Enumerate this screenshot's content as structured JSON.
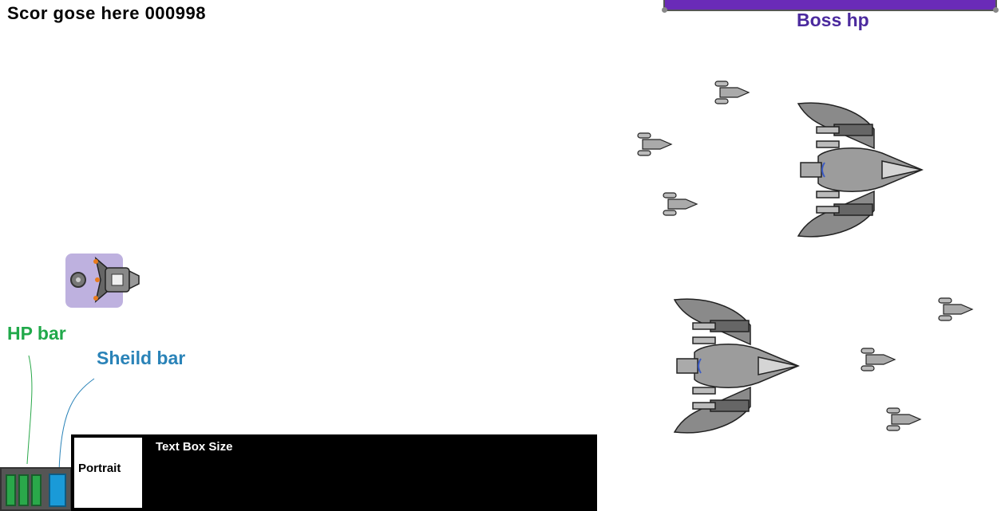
{
  "hud": {
    "score_text": "Scor gose here 000998",
    "boss_label": "Boss hp",
    "hp_label": "HP bar",
    "shield_label": "Sheild bar",
    "hp_segments": 3,
    "shield_fill": 1.0
  },
  "dialog": {
    "portrait_label": "Portrait",
    "textbox_label": "Text Box Size"
  },
  "colors": {
    "boss_bar": "#6a2bb8",
    "hp_green": "#2aa84a",
    "shield_blue": "#1a9ad8",
    "player_shield": "#b7a9dc"
  },
  "entities": {
    "player": {
      "name": "player-ship"
    },
    "bosses": [
      {
        "name": "boss-ship"
      },
      {
        "name": "boss-ship"
      }
    ],
    "fighters": [
      {
        "name": "fighter-ship"
      },
      {
        "name": "fighter-ship"
      },
      {
        "name": "fighter-ship"
      },
      {
        "name": "fighter-ship"
      },
      {
        "name": "fighter-ship"
      },
      {
        "name": "fighter-ship"
      }
    ]
  }
}
